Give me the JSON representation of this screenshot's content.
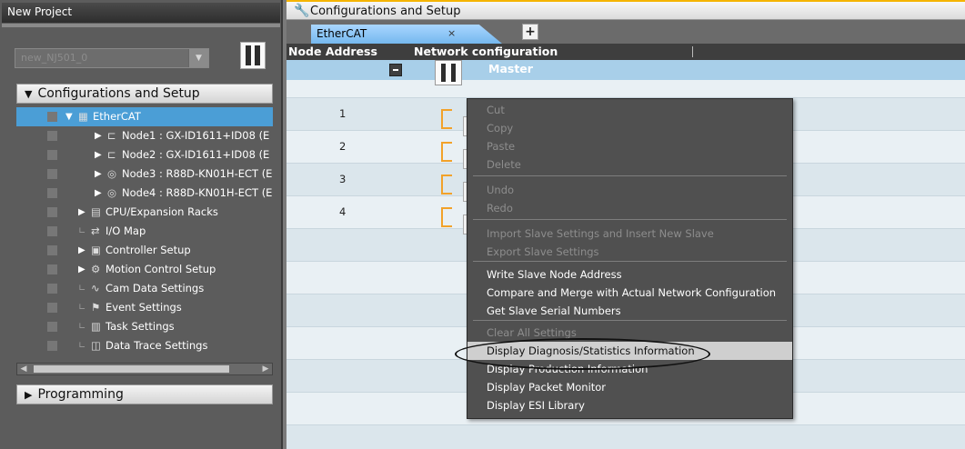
{
  "left_panel": {
    "title": "New Project",
    "device_select": {
      "value": "new_NJ501_0"
    },
    "sections": {
      "config": "Configurations and Setup",
      "programming": "Programming"
    },
    "tree": [
      {
        "label": "EtherCAT",
        "icon": "ethercat-icon",
        "selected": true
      },
      {
        "label": "Node1 : GX-ID1611+ID08 (E",
        "icon": "io-module-icon"
      },
      {
        "label": "Node2 : GX-ID1611+ID08 (E",
        "icon": "io-module-icon"
      },
      {
        "label": "Node3 : R88D-KN01H-ECT (E",
        "icon": "servo-icon"
      },
      {
        "label": "Node4 : R88D-KN01H-ECT (E",
        "icon": "servo-icon"
      },
      {
        "label": "CPU/Expansion Racks",
        "icon": "rack-icon"
      },
      {
        "label": "I/O Map",
        "icon": "io-map-icon"
      },
      {
        "label": "Controller Setup",
        "icon": "controller-setup-icon"
      },
      {
        "label": "Motion Control Setup",
        "icon": "gear-icon"
      },
      {
        "label": "Cam Data Settings",
        "icon": "cam-icon"
      },
      {
        "label": "Event Settings",
        "icon": "flag-icon"
      },
      {
        "label": "Task Settings",
        "icon": "task-icon"
      },
      {
        "label": "Data Trace Settings",
        "icon": "trace-icon"
      }
    ]
  },
  "right_panel": {
    "title": "Configurations and Setup",
    "tab": {
      "label": "EtherCAT",
      "close": "×",
      "add": "+"
    },
    "columns": {
      "node_address": "Node Address",
      "network_configuration": "Network configuration"
    },
    "master_label": "Master",
    "nodes": [
      "1",
      "2",
      "3",
      "4"
    ]
  },
  "context_menu": {
    "items": [
      {
        "label": "Cut",
        "enabled": false
      },
      {
        "label": "Copy",
        "enabled": false
      },
      {
        "label": "Paste",
        "enabled": false
      },
      {
        "label": "Delete",
        "enabled": false
      },
      {
        "label": "Undo",
        "enabled": false
      },
      {
        "label": "Redo",
        "enabled": false
      },
      {
        "label": "Import Slave Settings and Insert New Slave",
        "enabled": false
      },
      {
        "label": "Export Slave Settings",
        "enabled": false
      },
      {
        "label": "Write Slave Node Address",
        "enabled": true
      },
      {
        "label": "Compare and Merge with Actual Network Configuration",
        "enabled": true
      },
      {
        "label": "Get Slave Serial Numbers",
        "enabled": true
      },
      {
        "label": "Clear All Settings",
        "enabled": false
      },
      {
        "label": "Display Diagnosis/Statistics Information",
        "enabled": true,
        "highlighted": true
      },
      {
        "label": "Display Production Information",
        "enabled": true
      },
      {
        "label": "Display Packet Monitor",
        "enabled": true
      },
      {
        "label": "Display ESI Library",
        "enabled": true
      }
    ]
  },
  "colors": {
    "accent": "#f5b400",
    "selection": "#4b9ed6",
    "master_row": "#a8cfe9",
    "connector": "#f2a22a"
  }
}
